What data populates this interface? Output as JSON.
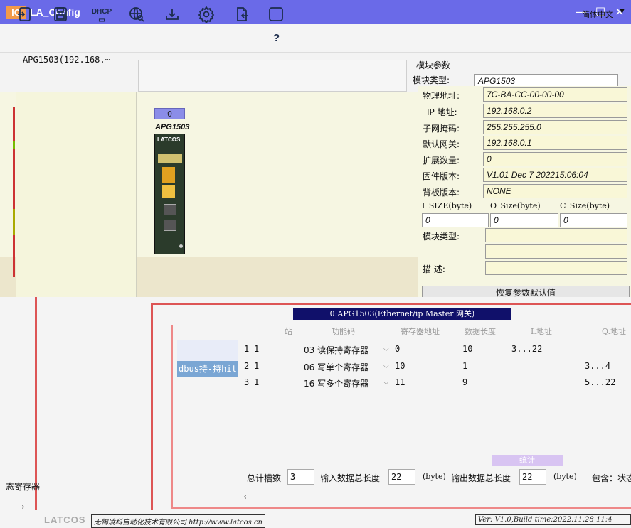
{
  "window": {
    "icon_text": "IO",
    "title": "LA_Config",
    "minimize": "—",
    "maximize": "☐",
    "close": "✕"
  },
  "toolbar": {
    "dhcp_label": "DHCP",
    "help_label": "?",
    "language": "简体中文",
    "language_arrow": "▼"
  },
  "tree": {
    "item": "APG1503(192.168.⋯"
  },
  "params": {
    "title": "模块参数",
    "type_label": "模块类型:",
    "type_value": "APG1503",
    "fields": [
      {
        "label": "物理地址:",
        "value": "7C-BA-CC-00-00-00"
      },
      {
        "label": "IP 地址:",
        "value": "192.168.0.2"
      },
      {
        "label": "子网掩码:",
        "value": "255.255.255.0"
      },
      {
        "label": "默认网关:",
        "value": "192.168.0.1"
      },
      {
        "label": "扩展数量:",
        "value": "0"
      },
      {
        "label": "固件版本:",
        "value": "V1.01 Dec 7 202215:06:04"
      },
      {
        "label": "背板版本:",
        "value": "NONE"
      }
    ],
    "size_headers": [
      "I_SIZE(byte)",
      "O_Size(byte)",
      "C_Size(byte)"
    ],
    "size_values": [
      "0",
      "0",
      "0"
    ],
    "module_type_label": "模块类型:",
    "module_type_value": "",
    "desc_label": "描    述:",
    "desc_value": "",
    "restore_button": "恢复参数默认值"
  },
  "device": {
    "slot_number": "0",
    "name": "APG1503",
    "brand": "LATCOS"
  },
  "modbus": {
    "group_title": "0:APG1503(Ethernet/ip Master 网关)",
    "tab_label": "dbus持‐持hit",
    "columns": [
      "站",
      "功能码",
      "寄存器地址",
      "数据长度",
      "I.地址",
      "Q.地址"
    ],
    "rows": [
      {
        "no": "1",
        "station": "1",
        "func": "03 读保持寄存器",
        "reg": "0",
        "len": "10",
        "i_addr": "3...22",
        "q_addr": ""
      },
      {
        "no": "2",
        "station": "1",
        "func": "06 写单个寄存器",
        "reg": "10",
        "len": "1",
        "i_addr": "",
        "q_addr": "3...4"
      },
      {
        "no": "3",
        "station": "1",
        "func": "16 写多个寄存器",
        "reg": "11",
        "len": "9",
        "i_addr": "",
        "q_addr": "5...22"
      }
    ],
    "stats_label": "统计",
    "total_slots_label": "总计槽数",
    "total_slots": "3",
    "input_total_label": "输入数据总长度",
    "input_total": "22",
    "output_total_label": "输出数据总长度",
    "output_total": "22",
    "unit": "(byte)",
    "contains_label": "包含：状态"
  },
  "left_panel": {
    "text": "态寄存器",
    "scroll_arrow": "›"
  },
  "footer": {
    "logo": "LATCOS",
    "company": "无锡凌科自动化技术有限公司 http://www.latcos.cn",
    "version": "Ver: V1.0,Build time:2022.11.28 11:4"
  }
}
